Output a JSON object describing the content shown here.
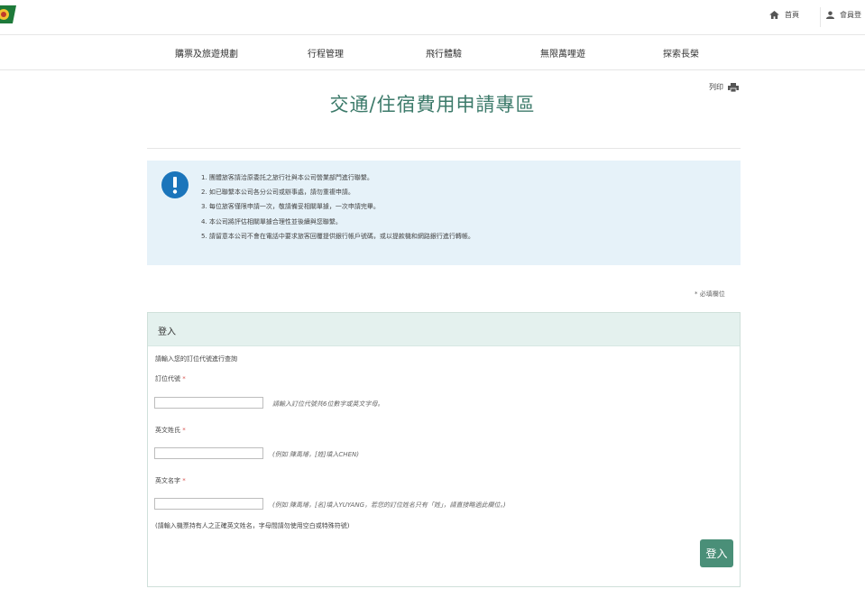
{
  "header": {
    "home_label": "首頁",
    "member_label": "會員登",
    "home_icon": "home-icon",
    "member_icon": "user-icon",
    "logo_color": "#1e7a3a"
  },
  "nav": {
    "items": [
      {
        "label": "購票及旅遊規劃"
      },
      {
        "label": "行程管理"
      },
      {
        "label": "飛行體驗"
      },
      {
        "label": "無限萬哩遊"
      },
      {
        "label": "探索長榮"
      }
    ]
  },
  "page": {
    "print_label": "列印",
    "title": "交通/住宿費用申請專區"
  },
  "notice": {
    "items": [
      "1. 團體旅客請洽原委託之旅行社與本公司營業部門進行聯繫。",
      "2. 如已聯繫本公司各分公司或辦事處，請勿重複申請。",
      "3. 每位旅客僅限申請一次，敬請備妥相關單據，一次申請完畢。",
      "4. 本公司將評估相關單據合理性並後續與您聯繫。",
      "5. 請留意本公司不會在電話中要求旅客回覆提供銀行帳戶號碼，或以提款機和網路銀行進行轉帳。"
    ],
    "bg_color": "#e6f2f9",
    "icon_color": "#1b75bb"
  },
  "form": {
    "required_note": "* 必填欄位",
    "panel_title": "登入",
    "intro": "請輸入您的訂位代號進行查詢",
    "fields": [
      {
        "label": "訂位代號",
        "value": "",
        "hint": "請輸入訂位代號共6位數字或英文字母。"
      },
      {
        "label": "英文姓氏",
        "value": "",
        "hint": "(例如 陳禹璿，[姓]填入CHEN)"
      },
      {
        "label": "英文名字",
        "value": "",
        "hint": "(例如 陳禹璿，[名]填入YUYANG，若您的訂位姓名只有「姓」，請直接略過此欄位。)"
      }
    ],
    "required_mark": "*",
    "footnote": "(請輸入機票持有人之正確英文姓名，字母間請勿使用空白或特殊符號)",
    "submit_label": "登入",
    "accent_color": "#4a8f78"
  }
}
